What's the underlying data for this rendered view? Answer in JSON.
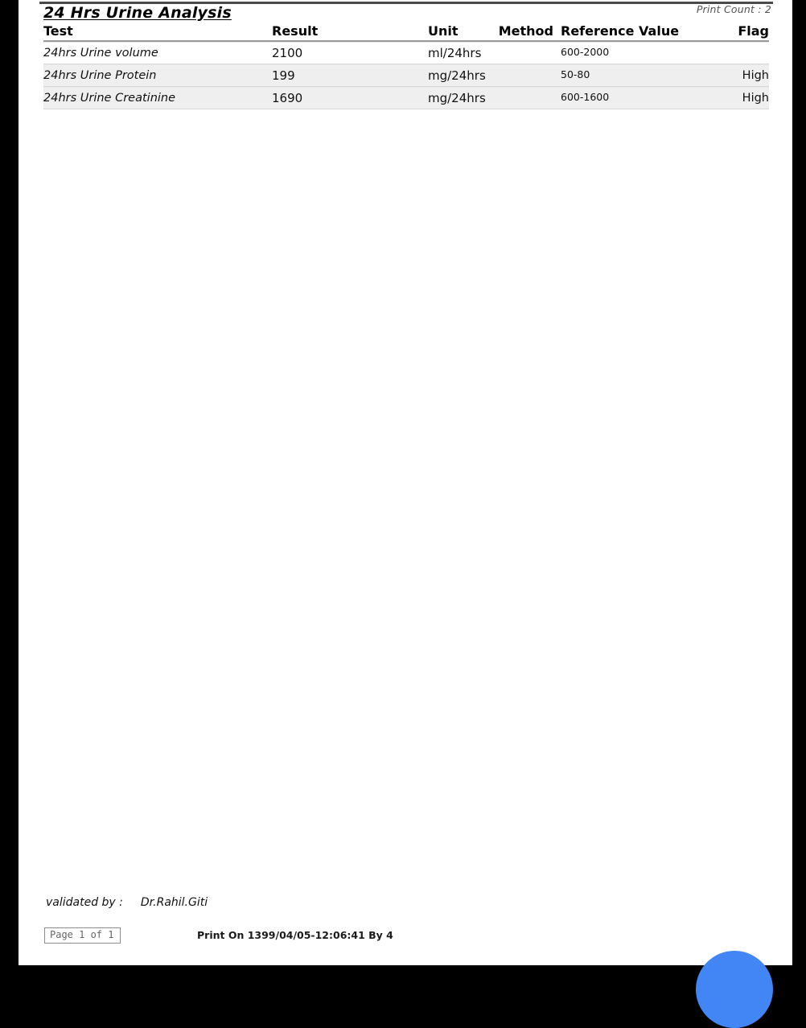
{
  "document": {
    "report_title": "24 Hrs Urine Analysis",
    "print_count_label": "Print Count : 2"
  },
  "table": {
    "columns": [
      {
        "key": "test",
        "label": "Test"
      },
      {
        "key": "result",
        "label": "Result"
      },
      {
        "key": "unit",
        "label": "Unit"
      },
      {
        "key": "method",
        "label": "Method"
      },
      {
        "key": "ref",
        "label": "Reference Value"
      },
      {
        "key": "flag",
        "label": "Flag"
      }
    ],
    "rows": [
      {
        "test": "24hrs Urine volume",
        "result": "2100",
        "unit": "ml/24hrs",
        "method": "",
        "ref": "600-2000",
        "flag": ""
      },
      {
        "test": "24hrs Urine Protein",
        "result": "199",
        "unit": "mg/24hrs",
        "method": "",
        "ref": "50-80",
        "flag": "High"
      },
      {
        "test": "24hrs Urine Creatinine",
        "result": "1690",
        "unit": "mg/24hrs",
        "method": "",
        "ref": "600-1600",
        "flag": "High"
      }
    ]
  },
  "footer": {
    "validated_by_label": "validated by  :",
    "validated_by_name": "Dr.Rahil.Giti",
    "page_indicator": "Page 1 of 1",
    "print_on": "Print On 1399/04/05-12:06:41 By 4"
  },
  "colors": {
    "fab": "#4285f4",
    "shaded_row": "#efefef",
    "rule": "#4a4a4a"
  }
}
